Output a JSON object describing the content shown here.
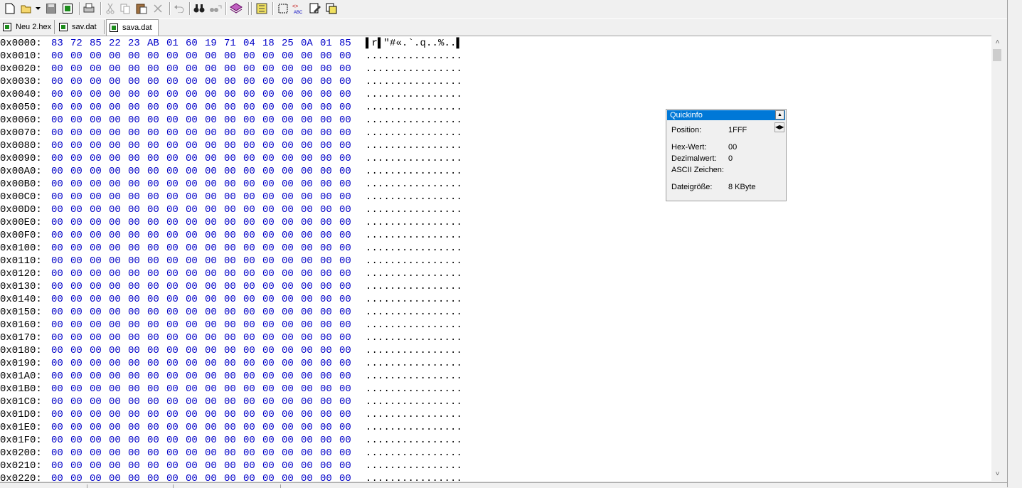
{
  "toolbar": {
    "icons": [
      "new-icon",
      "open-icon",
      "save-icon",
      "save-all-icon",
      "print-icon",
      "cut-icon",
      "copy-icon",
      "paste-icon",
      "delete-icon",
      "undo-icon",
      "find-icon",
      "find-next-icon",
      "book-icon",
      "compare-icon",
      "select-icon",
      "hex-abc-icon",
      "edit-icon",
      "copy-block-icon"
    ]
  },
  "tabs": [
    {
      "label": "Neu 2.hex"
    },
    {
      "label": "sav.dat"
    },
    {
      "label": "sava.dat"
    }
  ],
  "hex_rows": [
    {
      "addr": "0x0000:",
      "hex": [
        "83",
        "72",
        "85",
        "22",
        "23",
        "AB",
        "01",
        "60",
        "19",
        "71",
        "04",
        "18",
        "25",
        "0A",
        "01",
        "85"
      ],
      "ascii": "▌r▌\"#«.`.q..%..▌"
    },
    {
      "addr": "0x0010:",
      "hex": [
        "00",
        "00",
        "00",
        "00",
        "00",
        "00",
        "00",
        "00",
        "00",
        "00",
        "00",
        "00",
        "00",
        "00",
        "00",
        "00"
      ],
      "ascii": "................"
    },
    {
      "addr": "0x0020:",
      "hex": [
        "00",
        "00",
        "00",
        "00",
        "00",
        "00",
        "00",
        "00",
        "00",
        "00",
        "00",
        "00",
        "00",
        "00",
        "00",
        "00"
      ],
      "ascii": "................"
    },
    {
      "addr": "0x0030:",
      "hex": [
        "00",
        "00",
        "00",
        "00",
        "00",
        "00",
        "00",
        "00",
        "00",
        "00",
        "00",
        "00",
        "00",
        "00",
        "00",
        "00"
      ],
      "ascii": "................"
    },
    {
      "addr": "0x0040:",
      "hex": [
        "00",
        "00",
        "00",
        "00",
        "00",
        "00",
        "00",
        "00",
        "00",
        "00",
        "00",
        "00",
        "00",
        "00",
        "00",
        "00"
      ],
      "ascii": "................"
    },
    {
      "addr": "0x0050:",
      "hex": [
        "00",
        "00",
        "00",
        "00",
        "00",
        "00",
        "00",
        "00",
        "00",
        "00",
        "00",
        "00",
        "00",
        "00",
        "00",
        "00"
      ],
      "ascii": "................"
    },
    {
      "addr": "0x0060:",
      "hex": [
        "00",
        "00",
        "00",
        "00",
        "00",
        "00",
        "00",
        "00",
        "00",
        "00",
        "00",
        "00",
        "00",
        "00",
        "00",
        "00"
      ],
      "ascii": "................"
    },
    {
      "addr": "0x0070:",
      "hex": [
        "00",
        "00",
        "00",
        "00",
        "00",
        "00",
        "00",
        "00",
        "00",
        "00",
        "00",
        "00",
        "00",
        "00",
        "00",
        "00"
      ],
      "ascii": "................"
    },
    {
      "addr": "0x0080:",
      "hex": [
        "00",
        "00",
        "00",
        "00",
        "00",
        "00",
        "00",
        "00",
        "00",
        "00",
        "00",
        "00",
        "00",
        "00",
        "00",
        "00"
      ],
      "ascii": "................"
    },
    {
      "addr": "0x0090:",
      "hex": [
        "00",
        "00",
        "00",
        "00",
        "00",
        "00",
        "00",
        "00",
        "00",
        "00",
        "00",
        "00",
        "00",
        "00",
        "00",
        "00"
      ],
      "ascii": "................"
    },
    {
      "addr": "0x00A0:",
      "hex": [
        "00",
        "00",
        "00",
        "00",
        "00",
        "00",
        "00",
        "00",
        "00",
        "00",
        "00",
        "00",
        "00",
        "00",
        "00",
        "00"
      ],
      "ascii": "................"
    },
    {
      "addr": "0x00B0:",
      "hex": [
        "00",
        "00",
        "00",
        "00",
        "00",
        "00",
        "00",
        "00",
        "00",
        "00",
        "00",
        "00",
        "00",
        "00",
        "00",
        "00"
      ],
      "ascii": "................"
    },
    {
      "addr": "0x00C0:",
      "hex": [
        "00",
        "00",
        "00",
        "00",
        "00",
        "00",
        "00",
        "00",
        "00",
        "00",
        "00",
        "00",
        "00",
        "00",
        "00",
        "00"
      ],
      "ascii": "................"
    },
    {
      "addr": "0x00D0:",
      "hex": [
        "00",
        "00",
        "00",
        "00",
        "00",
        "00",
        "00",
        "00",
        "00",
        "00",
        "00",
        "00",
        "00",
        "00",
        "00",
        "00"
      ],
      "ascii": "................"
    },
    {
      "addr": "0x00E0:",
      "hex": [
        "00",
        "00",
        "00",
        "00",
        "00",
        "00",
        "00",
        "00",
        "00",
        "00",
        "00",
        "00",
        "00",
        "00",
        "00",
        "00"
      ],
      "ascii": "................"
    },
    {
      "addr": "0x00F0:",
      "hex": [
        "00",
        "00",
        "00",
        "00",
        "00",
        "00",
        "00",
        "00",
        "00",
        "00",
        "00",
        "00",
        "00",
        "00",
        "00",
        "00"
      ],
      "ascii": "................"
    },
    {
      "addr": "0x0100:",
      "hex": [
        "00",
        "00",
        "00",
        "00",
        "00",
        "00",
        "00",
        "00",
        "00",
        "00",
        "00",
        "00",
        "00",
        "00",
        "00",
        "00"
      ],
      "ascii": "................"
    },
    {
      "addr": "0x0110:",
      "hex": [
        "00",
        "00",
        "00",
        "00",
        "00",
        "00",
        "00",
        "00",
        "00",
        "00",
        "00",
        "00",
        "00",
        "00",
        "00",
        "00"
      ],
      "ascii": "................"
    },
    {
      "addr": "0x0120:",
      "hex": [
        "00",
        "00",
        "00",
        "00",
        "00",
        "00",
        "00",
        "00",
        "00",
        "00",
        "00",
        "00",
        "00",
        "00",
        "00",
        "00"
      ],
      "ascii": "................"
    },
    {
      "addr": "0x0130:",
      "hex": [
        "00",
        "00",
        "00",
        "00",
        "00",
        "00",
        "00",
        "00",
        "00",
        "00",
        "00",
        "00",
        "00",
        "00",
        "00",
        "00"
      ],
      "ascii": "................"
    },
    {
      "addr": "0x0140:",
      "hex": [
        "00",
        "00",
        "00",
        "00",
        "00",
        "00",
        "00",
        "00",
        "00",
        "00",
        "00",
        "00",
        "00",
        "00",
        "00",
        "00"
      ],
      "ascii": "................"
    },
    {
      "addr": "0x0150:",
      "hex": [
        "00",
        "00",
        "00",
        "00",
        "00",
        "00",
        "00",
        "00",
        "00",
        "00",
        "00",
        "00",
        "00",
        "00",
        "00",
        "00"
      ],
      "ascii": "................"
    },
    {
      "addr": "0x0160:",
      "hex": [
        "00",
        "00",
        "00",
        "00",
        "00",
        "00",
        "00",
        "00",
        "00",
        "00",
        "00",
        "00",
        "00",
        "00",
        "00",
        "00"
      ],
      "ascii": "................"
    },
    {
      "addr": "0x0170:",
      "hex": [
        "00",
        "00",
        "00",
        "00",
        "00",
        "00",
        "00",
        "00",
        "00",
        "00",
        "00",
        "00",
        "00",
        "00",
        "00",
        "00"
      ],
      "ascii": "................"
    },
    {
      "addr": "0x0180:",
      "hex": [
        "00",
        "00",
        "00",
        "00",
        "00",
        "00",
        "00",
        "00",
        "00",
        "00",
        "00",
        "00",
        "00",
        "00",
        "00",
        "00"
      ],
      "ascii": "................"
    },
    {
      "addr": "0x0190:",
      "hex": [
        "00",
        "00",
        "00",
        "00",
        "00",
        "00",
        "00",
        "00",
        "00",
        "00",
        "00",
        "00",
        "00",
        "00",
        "00",
        "00"
      ],
      "ascii": "................"
    },
    {
      "addr": "0x01A0:",
      "hex": [
        "00",
        "00",
        "00",
        "00",
        "00",
        "00",
        "00",
        "00",
        "00",
        "00",
        "00",
        "00",
        "00",
        "00",
        "00",
        "00"
      ],
      "ascii": "................"
    },
    {
      "addr": "0x01B0:",
      "hex": [
        "00",
        "00",
        "00",
        "00",
        "00",
        "00",
        "00",
        "00",
        "00",
        "00",
        "00",
        "00",
        "00",
        "00",
        "00",
        "00"
      ],
      "ascii": "................"
    },
    {
      "addr": "0x01C0:",
      "hex": [
        "00",
        "00",
        "00",
        "00",
        "00",
        "00",
        "00",
        "00",
        "00",
        "00",
        "00",
        "00",
        "00",
        "00",
        "00",
        "00"
      ],
      "ascii": "................"
    },
    {
      "addr": "0x01D0:",
      "hex": [
        "00",
        "00",
        "00",
        "00",
        "00",
        "00",
        "00",
        "00",
        "00",
        "00",
        "00",
        "00",
        "00",
        "00",
        "00",
        "00"
      ],
      "ascii": "................"
    },
    {
      "addr": "0x01E0:",
      "hex": [
        "00",
        "00",
        "00",
        "00",
        "00",
        "00",
        "00",
        "00",
        "00",
        "00",
        "00",
        "00",
        "00",
        "00",
        "00",
        "00"
      ],
      "ascii": "................"
    },
    {
      "addr": "0x01F0:",
      "hex": [
        "00",
        "00",
        "00",
        "00",
        "00",
        "00",
        "00",
        "00",
        "00",
        "00",
        "00",
        "00",
        "00",
        "00",
        "00",
        "00"
      ],
      "ascii": "................"
    },
    {
      "addr": "0x0200:",
      "hex": [
        "00",
        "00",
        "00",
        "00",
        "00",
        "00",
        "00",
        "00",
        "00",
        "00",
        "00",
        "00",
        "00",
        "00",
        "00",
        "00"
      ],
      "ascii": "................"
    },
    {
      "addr": "0x0210:",
      "hex": [
        "00",
        "00",
        "00",
        "00",
        "00",
        "00",
        "00",
        "00",
        "00",
        "00",
        "00",
        "00",
        "00",
        "00",
        "00",
        "00"
      ],
      "ascii": "................"
    },
    {
      "addr": "0x0220:",
      "hex": [
        "00",
        "00",
        "00",
        "00",
        "00",
        "00",
        "00",
        "00",
        "00",
        "00",
        "00",
        "00",
        "00",
        "00",
        "00",
        "00"
      ],
      "ascii": "................"
    }
  ],
  "quickinfo": {
    "title": "Quickinfo",
    "position_label": "Position:",
    "position_value": "1FFF",
    "hexwert_label": "Hex-Wert:",
    "hexwert_value": "00",
    "dezimal_label": "Dezimalwert:",
    "dezimal_value": "0",
    "ascii_label": "ASCII Zeichen:",
    "ascii_value": "",
    "size_label": "Dateigröße:",
    "size_value": "8 KByte"
  },
  "colors": {
    "hex_text": "#0000c8",
    "title_bar": "#0078d7"
  }
}
